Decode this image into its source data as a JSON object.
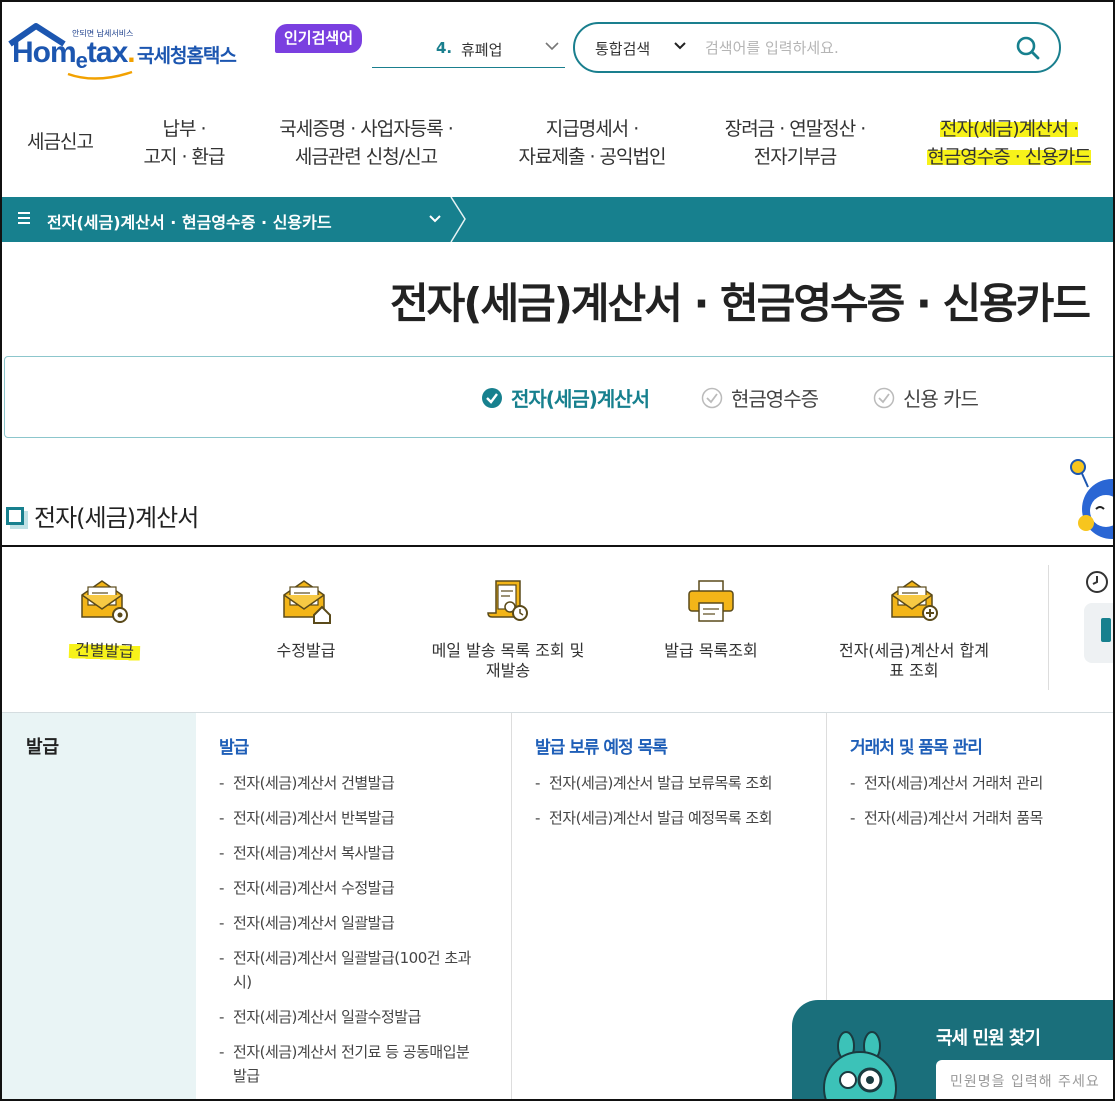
{
  "header": {
    "logo_tagline": "안되면 납세서비스",
    "logo_brand_pre": "Hom",
    "logo_brand_e": "e",
    "logo_brand_post": "tax",
    "logo_brand_dot": ".",
    "logo_korean": "국세청홈택스",
    "popular_badge": "인기검색어",
    "popular_rank": "4.",
    "popular_word": "휴폐업",
    "search_scope": "통합검색",
    "search_placeholder": "검색어를 입력하세요."
  },
  "gnb": {
    "items": [
      {
        "line1": "세금신고",
        "line2": ""
      },
      {
        "line1": "납부 ·",
        "line2": "고지 · 환급"
      },
      {
        "line1": "국세증명 · 사업자등록 ·",
        "line2": "세금관련 신청/신고"
      },
      {
        "line1": "지급명세서 ·",
        "line2": "자료제출 · 공익법인"
      },
      {
        "line1": "장려금 · 연말정산 ·",
        "line2": "전자기부금"
      },
      {
        "line1": "전자(세금)계산서 ·",
        "line2": "현금영수증 · 신용카드"
      }
    ]
  },
  "location": {
    "label": "전자(세금)계산서 · 현금영수증 · 신용카드"
  },
  "page_title": "전자(세금)계산서 · 현금영수증 · 신용카드",
  "tabs": [
    {
      "label": "전자(세금)계산서",
      "active": true
    },
    {
      "label": "현금영수증",
      "active": false
    },
    {
      "label": "신용 카드",
      "active": false
    }
  ],
  "section_title": "전자(세금)계산서",
  "quick_menu": [
    {
      "label": "건별발급",
      "icon": "envelope-gear-icon"
    },
    {
      "label": "수정발급",
      "icon": "envelope-home-icon"
    },
    {
      "label": "메일 발송 목록 조회 및 재발송",
      "icon": "scroll-document-icon"
    },
    {
      "label": "발급 목록조회",
      "icon": "printer-icon"
    },
    {
      "label": "전자(세금)계산서 합계표 조회",
      "icon": "envelope-plus-icon"
    }
  ],
  "mega": {
    "category": "발급",
    "columns": [
      {
        "title": "발급",
        "items": [
          "전자(세금)계산서 건별발급",
          "전자(세금)계산서 반복발급",
          "전자(세금)계산서 복사발급",
          "전자(세금)계산서 수정발급",
          "전자(세금)계산서 일괄발급",
          "전자(세금)계산서 일괄발급(100건 초과 시)",
          "전자(세금)계산서 일괄수정발급",
          "전자(세금)계산서 전기료 등 공동매입분 발급"
        ]
      },
      {
        "title": "발급 보류 예정 목록",
        "items": [
          "전자(세금)계산서 발급 보류목록 조회",
          "전자(세금)계산서 발급 예정목록 조회"
        ]
      },
      {
        "title": "거래처 및 품목 관리",
        "items": [
          "전자(세금)계산서 거래처 관리",
          "전자(세금)계산서 거래처 품목"
        ]
      }
    ]
  },
  "civil_panel": {
    "title": "국세 민원 찾기",
    "placeholder": "민원명을 입력해 주세요"
  },
  "colors": {
    "teal": "#17808e",
    "highlight": "#f7f21a",
    "brand_blue": "#1c56b0",
    "badge_purple": "#7a3fe0",
    "link_blue": "#1f5fb8"
  }
}
